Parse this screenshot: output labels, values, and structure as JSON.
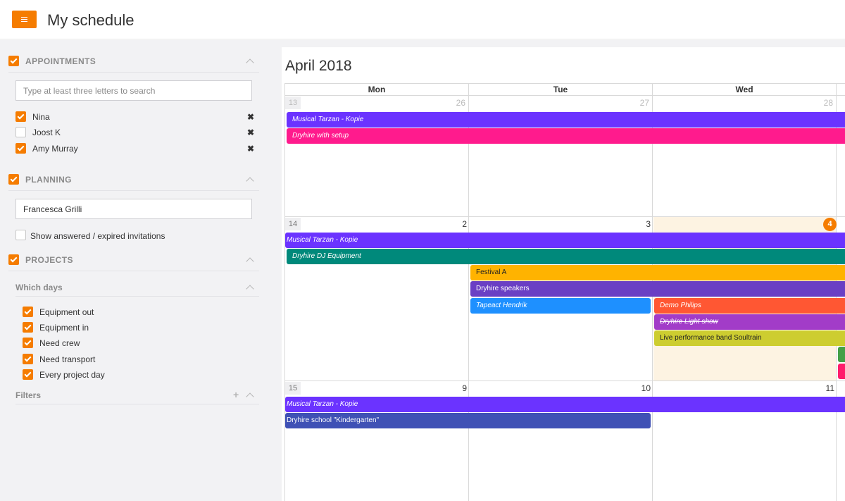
{
  "header": {
    "title": "My schedule",
    "menu_icon": "menu-icon"
  },
  "sidebar": {
    "appointments": {
      "label": "APPOINTMENTS",
      "checked": true,
      "search_placeholder": "Type at least three letters to search",
      "people": [
        {
          "name": "Nina",
          "checked": true
        },
        {
          "name": "Joost K",
          "checked": false
        },
        {
          "name": "Amy Murray",
          "checked": true
        }
      ],
      "remove_glyph": "✖"
    },
    "planning": {
      "label": "PLANNING",
      "checked": true,
      "person_value": "Francesca Grilli",
      "show_expired_label": "Show answered / expired invitations",
      "show_expired_checked": false
    },
    "projects": {
      "label": "PROJECTS",
      "checked": true,
      "which_days_label": "Which days",
      "days": [
        {
          "label": "Equipment out",
          "checked": true
        },
        {
          "label": "Equipment in",
          "checked": true
        },
        {
          "label": "Need crew",
          "checked": true
        },
        {
          "label": "Need transport",
          "checked": true
        },
        {
          "label": "Every project day",
          "checked": true
        }
      ],
      "filters_label": "Filters",
      "add_glyph": "+"
    }
  },
  "calendar": {
    "month": "April 2018",
    "days_of_week": [
      "Mon",
      "Tue",
      "Wed"
    ],
    "weeks": [
      {
        "week": "13",
        "days": [
          "26",
          "27",
          "28"
        ]
      },
      {
        "week": "14",
        "days": [
          "2",
          "3",
          "4"
        ]
      },
      {
        "week": "15",
        "days": [
          "9",
          "10",
          "11"
        ]
      }
    ],
    "today": "4",
    "events": {
      "w13_1": "Musical Tarzan - Kopie",
      "w13_2": "Dryhire with setup",
      "w14_1": "Musical Tarzan - Kopie",
      "w14_2": "Dryhire DJ Equipment",
      "w14_3": "Festival A",
      "w14_4": "Dryhire speakers",
      "w14_5": "Tapeact Hendrik",
      "w14_6": "Demo Philips",
      "w14_7": "Dryhire Light show",
      "w14_8": "Live performance band Soultrain",
      "w15_1": "Musical Tarzan - Kopie",
      "w15_2": "Dryhire school \"Kindergarten\""
    },
    "colors": {
      "accent": "#f57c00",
      "purple": "#6b33ff",
      "pink": "#ff1b8d",
      "teal": "#00897b",
      "amber": "#ffb300",
      "violet": "#6a3fc4",
      "blue": "#1e90ff",
      "orange_red": "#ff5733",
      "magenta": "#a23cc8",
      "olive": "#cdcd30",
      "indigo": "#3f51b5"
    }
  }
}
